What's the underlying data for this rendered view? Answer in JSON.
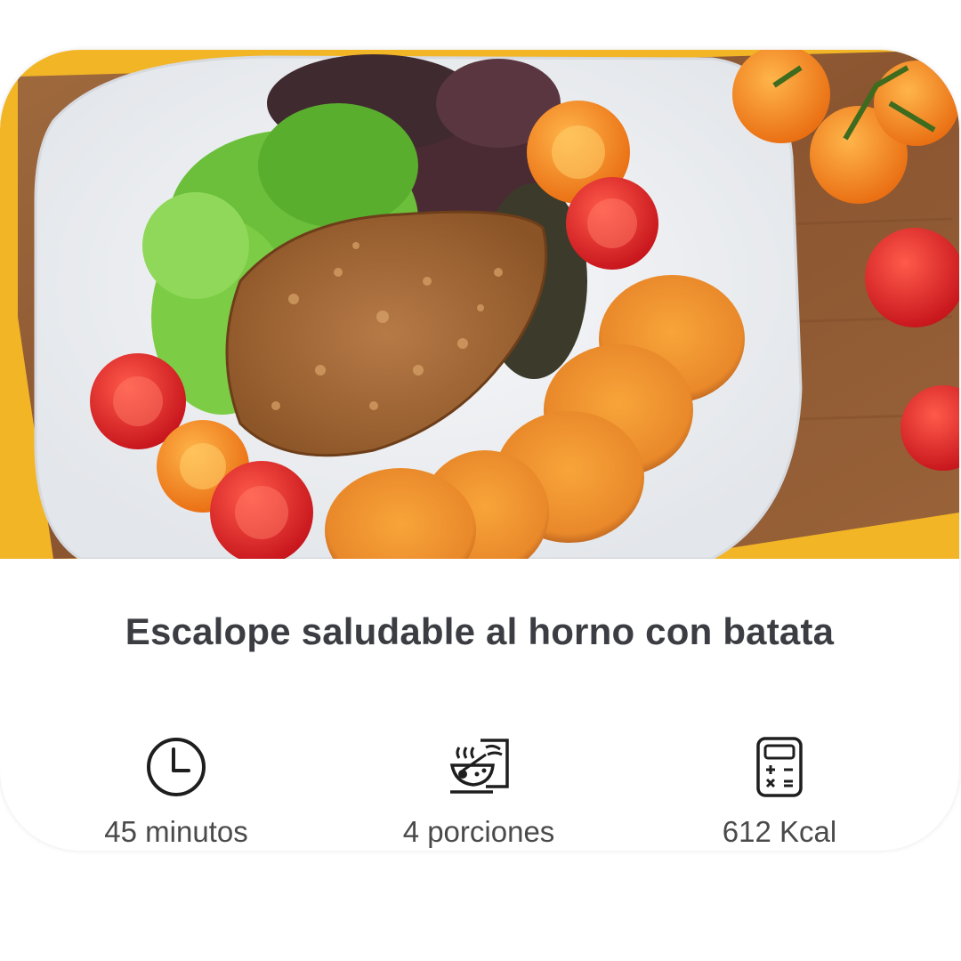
{
  "recipe": {
    "title": "Escalope saludable al horno con batata",
    "stats": {
      "time": {
        "label": "45 minutos",
        "icon": "clock-icon"
      },
      "portions": {
        "label": "4 porciones",
        "icon": "bowl-portions-icon"
      },
      "calories": {
        "label": "612 Kcal",
        "icon": "calculator-icon"
      }
    }
  },
  "colors": {
    "title_text": "#3b3d42",
    "stat_text": "#4a4a4a",
    "card_background": "#ffffff",
    "photo_yellow_mat": "#f2b526",
    "photo_wood_board": "#8a5a33",
    "photo_plate": "#f3f4f6"
  }
}
